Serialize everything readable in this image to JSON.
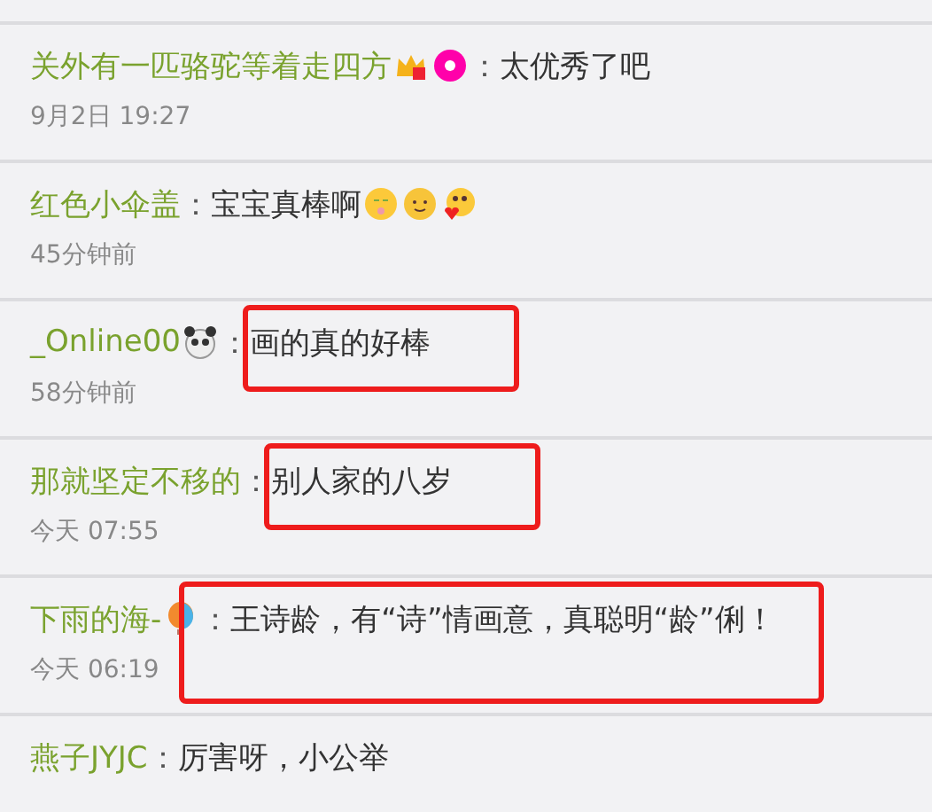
{
  "comments": [
    {
      "user": "关外有一匹骆驼等着走四方",
      "user_icons": [
        {
          "kind": "crown"
        },
        {
          "kind": "donut"
        }
      ],
      "sep": "：",
      "text": "太优秀了吧",
      "time": "9月2日 19:27",
      "highlighted": false
    },
    {
      "user": "红色小伞盖",
      "sep": "：",
      "text": "宝宝真棒啊",
      "text_icons": [
        {
          "kind": "face"
        },
        {
          "kind": "sun"
        },
        {
          "kind": "heart-face"
        }
      ],
      "time": "45分钟前",
      "highlighted": false
    },
    {
      "user": "_Online00",
      "user_icons": [
        {
          "kind": "panda"
        }
      ],
      "sep": "：",
      "text": "画的真的好棒",
      "time": "58分钟前",
      "highlighted": true
    },
    {
      "user": "那就坚定不移的",
      "sep": "：",
      "text": "别人家的八岁",
      "time": "今天 07:55",
      "highlighted": true
    },
    {
      "user": "下雨的海-",
      "user_icons": [
        {
          "kind": "balloon"
        }
      ],
      "sep": "：",
      "text": "王诗龄，有“诗”情画意，真聪明“龄”俐！",
      "time": "今天 06:19",
      "highlighted": true
    },
    {
      "user": "燕子JYJC",
      "sep": "：",
      "text": "厉害呀，小公举",
      "highlighted": false
    }
  ]
}
